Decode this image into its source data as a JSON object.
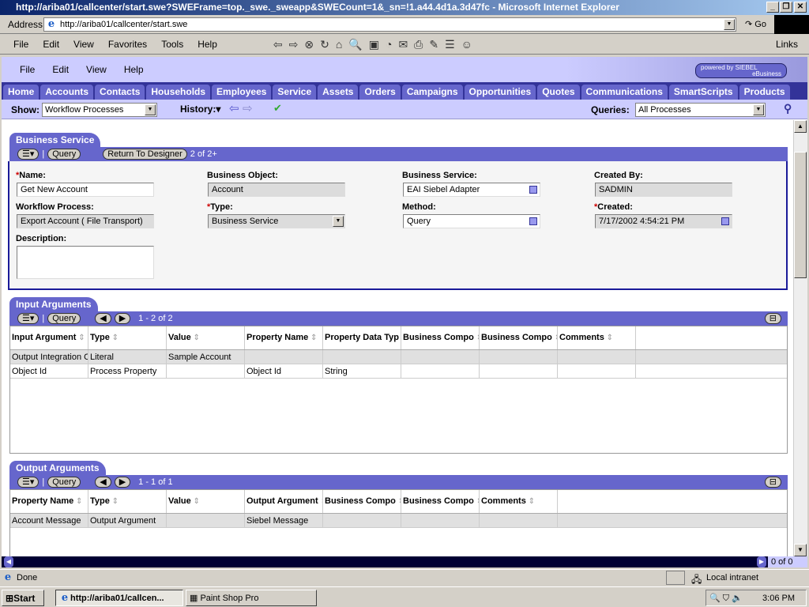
{
  "window": {
    "title": "http://ariba01/callcenter/start.swe?SWEFrame=top._swe._sweapp&SWECount=1&_sn=!1.a44.4d1a.3d47fc - Microsoft Internet Explorer"
  },
  "address": {
    "label": "Address",
    "url": "http://ariba01/callcenter/start.swe",
    "go": "Go"
  },
  "ie_menu": [
    "File",
    "Edit",
    "View",
    "Favorites",
    "Tools",
    "Help"
  ],
  "links": "Links",
  "app_menu": [
    "File",
    "Edit",
    "View",
    "Help"
  ],
  "logo": {
    "line1": "powered by SIEBEL",
    "line2": "eBusiness"
  },
  "tabs": [
    "Home",
    "Accounts",
    "Contacts",
    "Households",
    "Employees",
    "Service",
    "Assets",
    "Orders",
    "Campaigns",
    "Opportunities",
    "Quotes",
    "Communications",
    "SmartScripts",
    "Products"
  ],
  "showbar": {
    "show_label": "Show:",
    "show_value": "Workflow Processes",
    "history": "History:",
    "queries_label": "Queries:",
    "queries_value": "All Processes"
  },
  "business_service": {
    "title": "Business Service",
    "query": "Query",
    "return": "Return To Designer",
    "count": "2 of 2+",
    "name_label": "Name:",
    "name": "Get New Account",
    "wf_label": "Workflow Process:",
    "wf": "Export Account ( File Transport)",
    "desc_label": "Description:",
    "desc": "",
    "bo_label": "Business Object:",
    "bo": "Account",
    "type_label": "Type:",
    "type": "Business Service",
    "bs_label": "Business Service:",
    "bs": "EAI Siebel Adapter",
    "method_label": "Method:",
    "method": "Query",
    "cb_label": "Created By:",
    "cb": "SADMIN",
    "created_label": "Created:",
    "created": "7/17/2002 4:54:21 PM"
  },
  "input_args": {
    "title": "Input Arguments",
    "query": "Query",
    "count": "1 - 2 of 2",
    "columns": [
      "Input Argument",
      "Type",
      "Value",
      "Property Name",
      "Property Data Typ",
      "Business Compo",
      "Business Compo",
      "Comments"
    ],
    "rows": [
      [
        "Output Integration O",
        "Literal",
        "Sample Account",
        "",
        "",
        "",
        "",
        ""
      ],
      [
        "Object Id",
        "Process Property",
        "",
        "Object Id",
        "String",
        "",
        "",
        ""
      ]
    ]
  },
  "output_args": {
    "title": "Output Arguments",
    "query": "Query",
    "count": "1 - 1 of 1",
    "columns": [
      "Property Name",
      "Type",
      "Value",
      "Output Argument",
      "Business Compo",
      "Business Compo",
      "Comments"
    ],
    "rows": [
      [
        "Account Message",
        "Output Argument",
        "",
        "Siebel Message",
        "",
        "",
        ""
      ]
    ]
  },
  "hscroll": {
    "count": "0 of 0"
  },
  "status": {
    "text": "Done",
    "zone": "Local intranet"
  },
  "taskbar": {
    "start": "Start",
    "tasks": [
      "http://ariba01/callcen...",
      "Paint Shop Pro"
    ],
    "clock": "3:06 PM"
  }
}
